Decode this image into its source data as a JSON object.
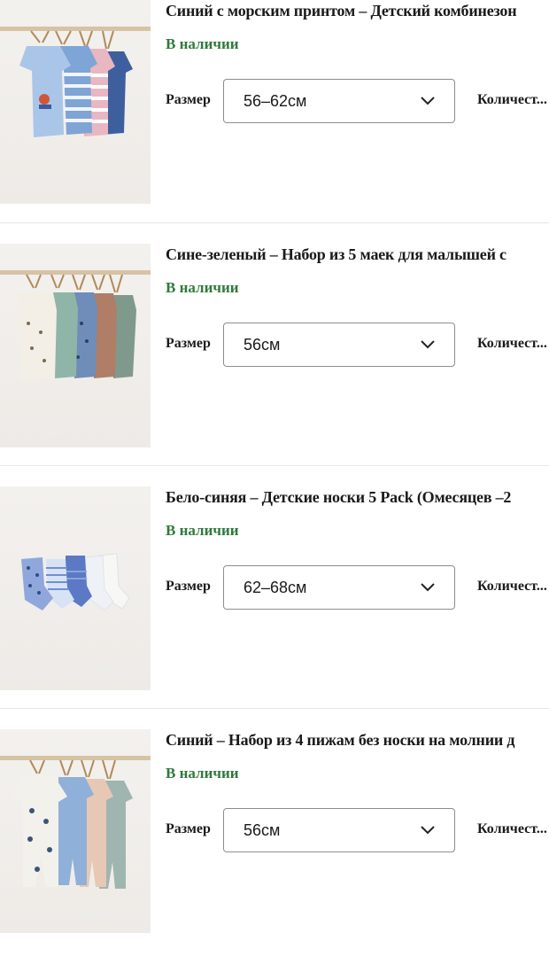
{
  "items": [
    {
      "title": "Синий с морским принтом – Детский комбинезон",
      "stock": "В наличии",
      "size_label": "Размер",
      "size_value": "56–62см",
      "qty_label": "Количест...",
      "image_icon": "romper-set-icon"
    },
    {
      "title": "Сине-зеленый – Набор из 5 маек для малышей с",
      "stock": "В наличии",
      "size_label": "Размер",
      "size_value": "56см",
      "qty_label": "Количест...",
      "image_icon": "bodysuit-set-icon"
    },
    {
      "title": "Бело-синяя – Детские носки 5 Pack (Омесяцев –2",
      "stock": "В наличии",
      "size_label": "Размер",
      "size_value": "62–68см",
      "qty_label": "Количест...",
      "image_icon": "socks-icon"
    },
    {
      "title": "Синий – Набор из 4 пижам без носки на молнии д",
      "stock": "В наличии",
      "size_label": "Размер",
      "size_value": "56см",
      "qty_label": "Количест...",
      "image_icon": "pajama-set-icon"
    }
  ],
  "colors": {
    "stock": "#2f7a3c",
    "rail": "#d6c3a4",
    "divider": "#e6e6e6"
  }
}
